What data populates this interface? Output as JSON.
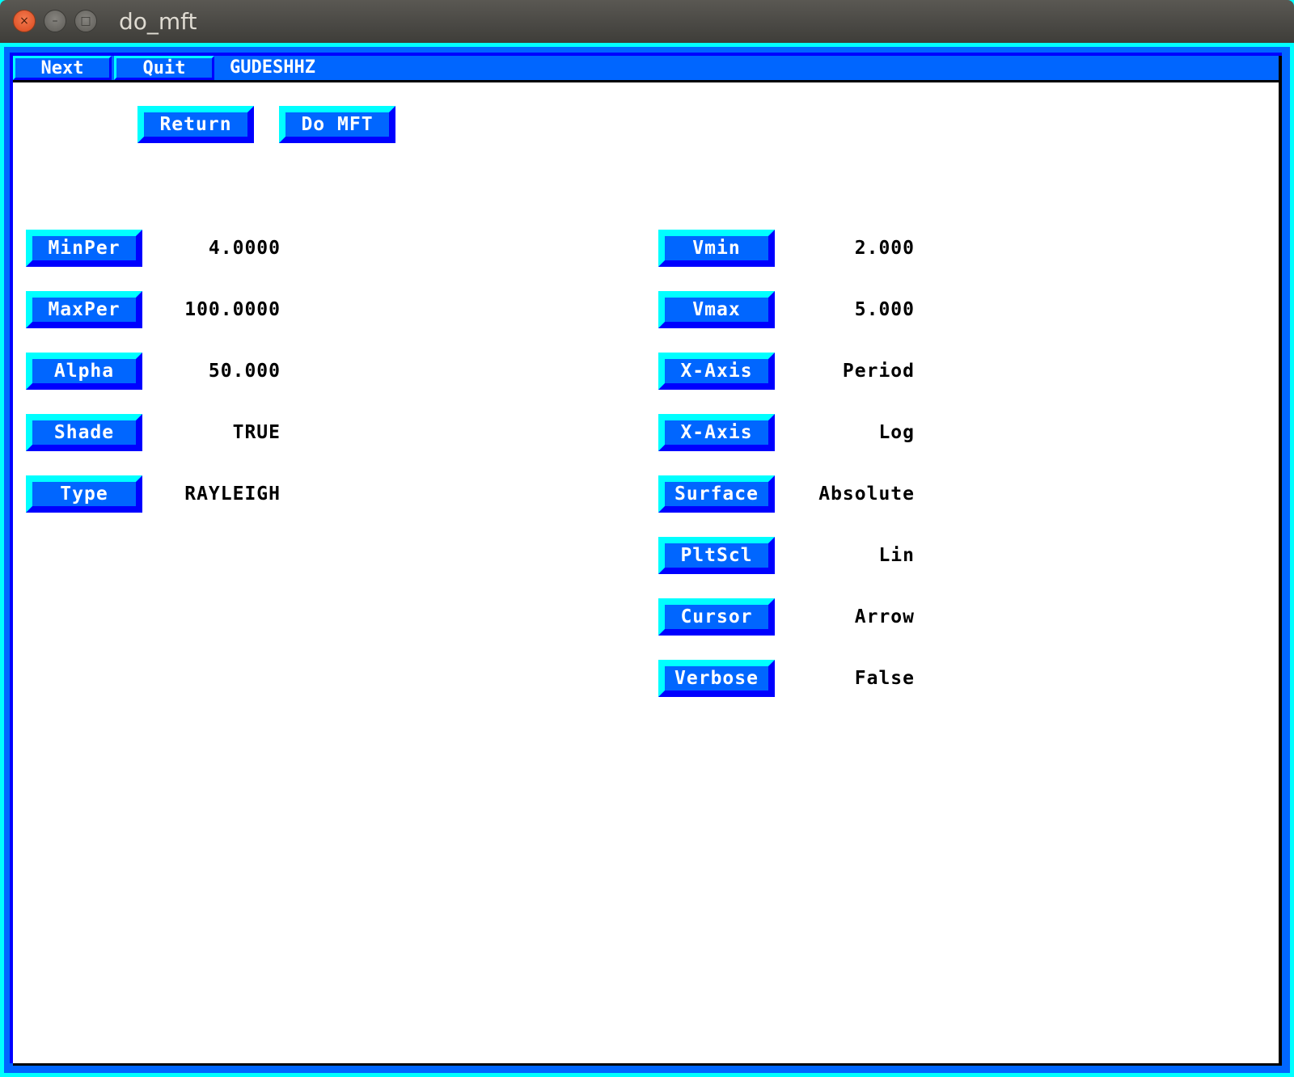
{
  "window": {
    "title": "do_mft",
    "controls": [
      "close-icon",
      "minimize-icon",
      "maximize-icon"
    ],
    "close_glyph": "×",
    "minimize_glyph": "–",
    "maximize_glyph": "□"
  },
  "menubar": {
    "next_label": "Next",
    "quit_label": "Quit",
    "station": "GUDESHHZ"
  },
  "actions": {
    "return_label": "Return",
    "do_mft_label": "Do MFT"
  },
  "left_params": [
    {
      "label": "MinPer",
      "value": "4.0000"
    },
    {
      "label": "MaxPer",
      "value": "100.0000"
    },
    {
      "label": "Alpha",
      "value": "50.000"
    },
    {
      "label": "Shade",
      "value": "TRUE"
    },
    {
      "label": "Type",
      "value": "RAYLEIGH"
    }
  ],
  "right_params": [
    {
      "label": "Vmin",
      "value": "2.000"
    },
    {
      "label": "Vmax",
      "value": "5.000"
    },
    {
      "label": "X-Axis",
      "value": "Period"
    },
    {
      "label": "X-Axis",
      "value": "Log"
    },
    {
      "label": "Surface",
      "value": "Absolute"
    },
    {
      "label": "PltScl",
      "value": "Lin"
    },
    {
      "label": "Cursor",
      "value": "Arrow"
    },
    {
      "label": "Verbose",
      "value": "False"
    }
  ],
  "colors": {
    "frame_cyan": "#00ffff",
    "frame_blue": "#0066ff",
    "bevel_dark": "#0000ff",
    "content_bg": "#ffffff"
  }
}
